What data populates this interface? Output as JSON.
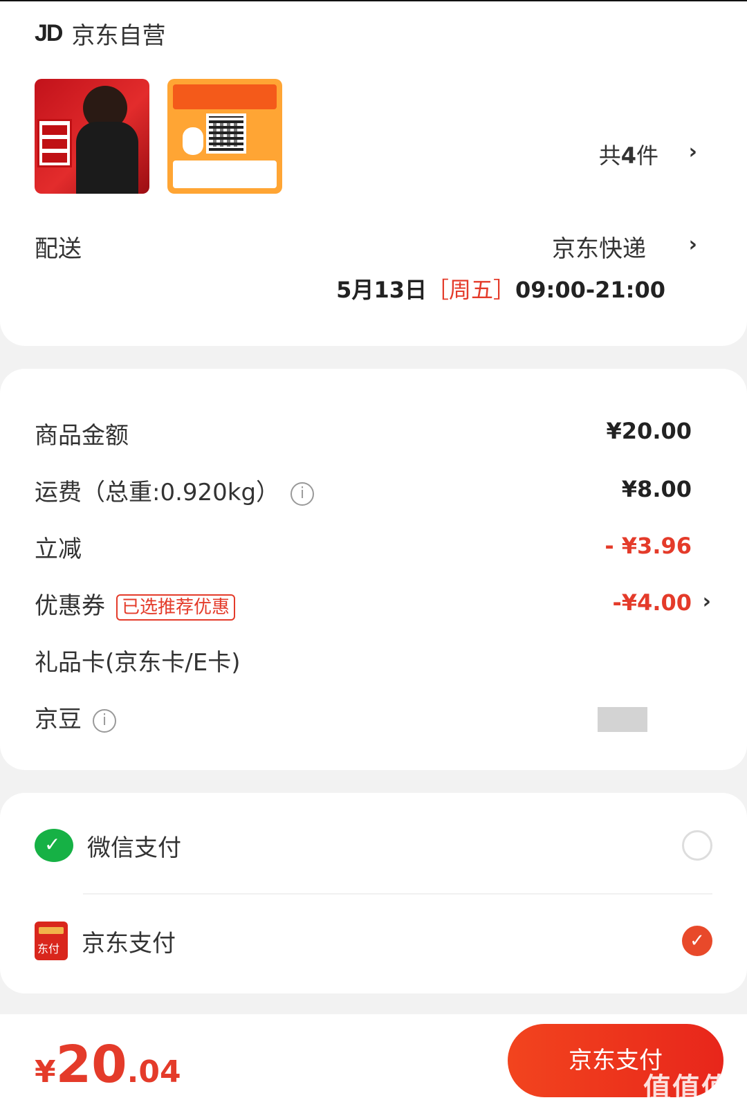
{
  "shop": {
    "logo": "JD",
    "name": "京东自营",
    "item_count_prefix": "共",
    "item_count": "4",
    "item_count_suffix": "件"
  },
  "delivery": {
    "label": "配送",
    "method": "京东快递",
    "date": "5月13日",
    "weekday": "［周五］",
    "time": "09:00-21:00"
  },
  "fees": {
    "goods_label": "商品金额",
    "goods_value": "¥20.00",
    "shipping_label": "运费（总重:0.920kg）",
    "shipping_value": "¥8.00",
    "discount_label": "立减",
    "discount_value": "- ¥3.96",
    "coupon_label": "优惠券",
    "coupon_tag": "已选推荐优惠",
    "coupon_value": "-¥4.00",
    "giftcard_label": "礼品卡(京东卡/E卡)",
    "jingdou_label": "京豆"
  },
  "payment": {
    "wechat_label": "微信支付",
    "jdpay_label": "京东支付",
    "jdpay_icon_text": "东付",
    "selected": "jdpay"
  },
  "footer": {
    "currency": "¥",
    "total_int": "20",
    "total_dec": ".04",
    "pay_button": "京东支付",
    "watermark": "值值值",
    "watermark_url": "zhizhizhi.com"
  },
  "colors": {
    "accent": "#e43b2a",
    "wechat": "#16b145",
    "jd_red": "#d9261c"
  }
}
